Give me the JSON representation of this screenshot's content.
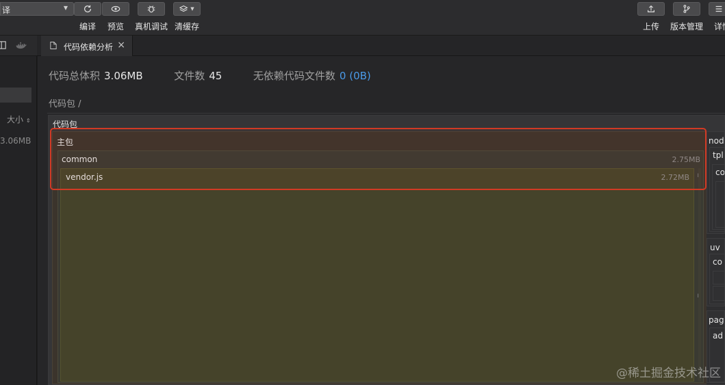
{
  "toolbar": {
    "mode_value": "译",
    "buttons": [
      {
        "label": "编译",
        "icon": "refresh-icon"
      },
      {
        "label": "预览",
        "icon": "eye-icon"
      },
      {
        "label": "真机调试",
        "icon": "bug-icon"
      },
      {
        "label": "清缓存",
        "icon": "layers-icon"
      }
    ],
    "right_buttons": [
      {
        "label": "上传",
        "icon": "upload-icon"
      },
      {
        "label": "版本管理",
        "icon": "branch-icon"
      },
      {
        "label": "详情",
        "icon": "menu-icon"
      }
    ]
  },
  "sidebar": {
    "size_sort_label": "大小",
    "total_value": "3.06MB"
  },
  "tab": {
    "label": "代码依赖分析",
    "close": "×"
  },
  "stats": {
    "total_size_label": "代码总体积",
    "total_size_value": "3.06MB",
    "file_count_label": "文件数",
    "file_count_value": "45",
    "no_dep_label": "无依赖代码文件数",
    "no_dep_value": "0 (0B)"
  },
  "breadcrumb": "代码包 /",
  "package_area": {
    "title": "代码包",
    "main_package": {
      "label": "主包",
      "common": {
        "name": "common",
        "size": "2.75MB",
        "vendor": {
          "name": "vendor.js",
          "size": "2.72MB"
        }
      }
    },
    "right_column": [
      "nod",
      "tpl",
      "co",
      "uv",
      "co",
      "pag",
      "ad"
    ]
  },
  "watermark": "@稀土掘金技术社区",
  "colors": {
    "highlight": "#d23a24",
    "link_blue": "#4a9ae8"
  }
}
